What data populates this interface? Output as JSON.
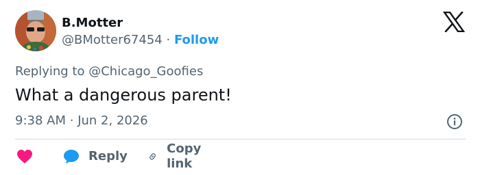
{
  "user": {
    "display_name": "B.Motter",
    "handle": "@BMotter67454",
    "separator": "·",
    "follow_label": "Follow"
  },
  "tweet": {
    "replying_prefix": "Replying to",
    "replying_to": "@Chicago_Goofies",
    "text": "What a dangerous parent!",
    "time": "9:38 AM",
    "meta_separator": "·",
    "date": "Jun 2, 2026"
  },
  "actions": {
    "like_icon": "heart-icon",
    "reply_label": "Reply",
    "copy_link_label": "Copy link"
  },
  "colors": {
    "like": "#f91880",
    "reply_bubble": "#1d9bf0",
    "follow": "#1d9bf0",
    "muted": "#536471"
  }
}
